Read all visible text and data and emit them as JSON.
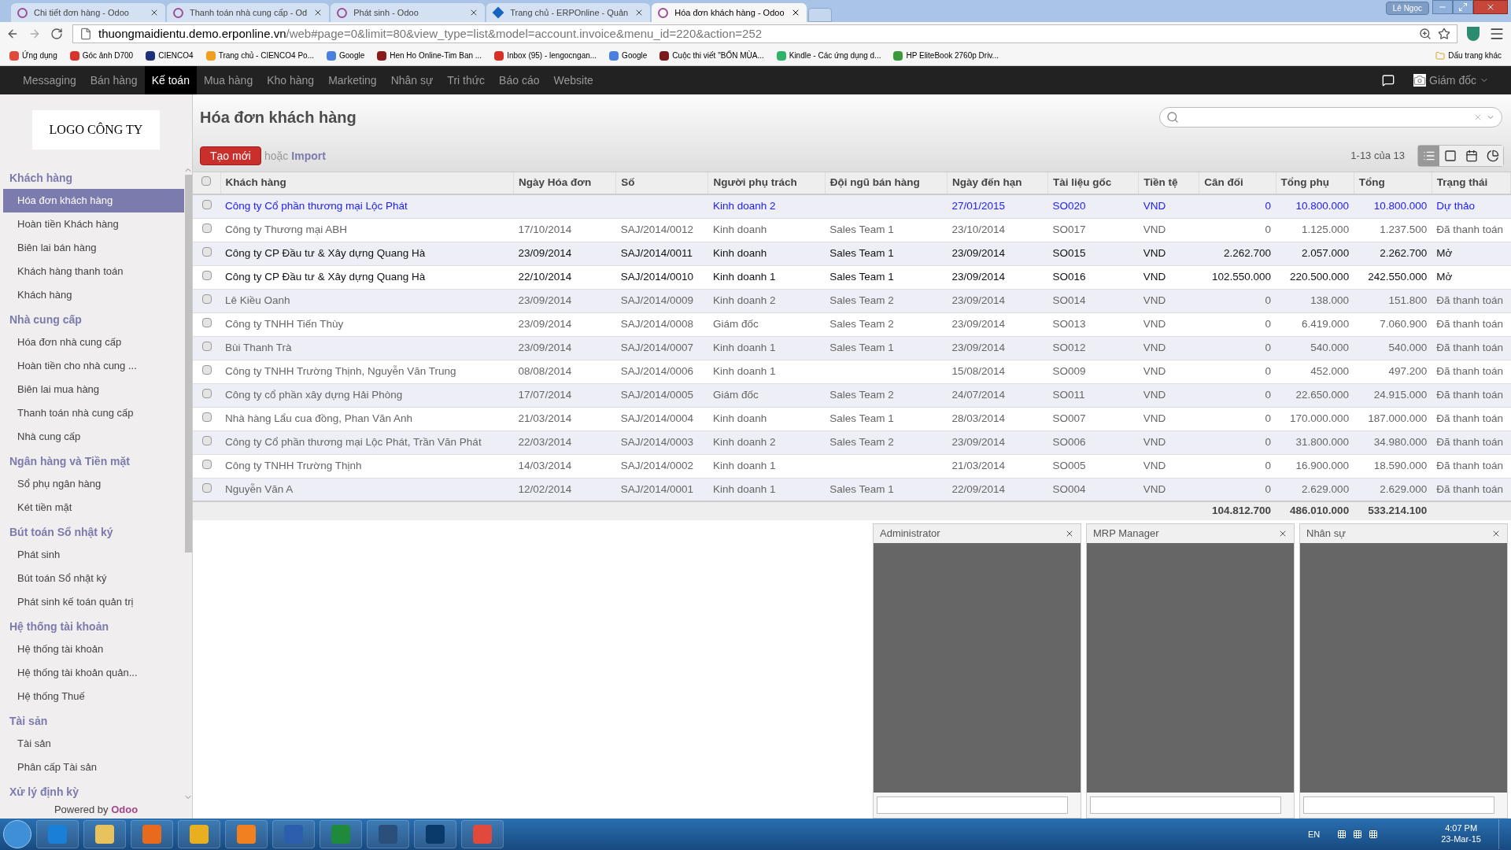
{
  "browser": {
    "tabs": [
      {
        "title": "Chi tiết đơn hàng - Odoo",
        "kind": "odoo",
        "selected": false
      },
      {
        "title": "Thanh toán nhà cung cấp - Od",
        "kind": "odoo",
        "selected": false
      },
      {
        "title": "Phát sinh - Odoo",
        "kind": "odoo",
        "selected": false
      },
      {
        "title": "Trang chủ - ERPOnline - Quản",
        "kind": "erp",
        "selected": false
      },
      {
        "title": "Hóa đơn khách hàng - Odoo",
        "kind": "odoo",
        "selected": true
      }
    ],
    "profile": "Lê Ngọc",
    "url_host": "thuongmaidientu.demo.erponline.vn",
    "url_path": "/web#page=0&limit=80&view_type=list&model=account.invoice&menu_id=220&action=252",
    "bookmarks": [
      {
        "label": "Ứng dụng",
        "color": "#e04a3c"
      },
      {
        "label": "Góc ảnh D700",
        "color": "#d9342b"
      },
      {
        "label": "CIENCO4",
        "color": "#1f2f7a"
      },
      {
        "label": "Trang chủ - CIENCO4 Po...",
        "color": "#f0a020"
      },
      {
        "label": "Google",
        "color": "#4a7fe0"
      },
      {
        "label": "Hen Ho Online-Tim Ban ...",
        "color": "#8b1a1a"
      },
      {
        "label": "Inbox (95) - lengocngan...",
        "color": "#d93025"
      },
      {
        "label": "Google",
        "color": "#4a7fe0"
      },
      {
        "label": "Cuộc thi viết \"BỐN MÙA...",
        "color": "#7a1a1a"
      },
      {
        "label": "Kindle - Các ứng dụng d...",
        "color": "#2fb36b"
      },
      {
        "label": "HP EliteBook 2760p Driv...",
        "color": "#3a9a3a"
      }
    ],
    "other_bookmarks": "Dấu trang khác"
  },
  "nav": {
    "items": [
      {
        "label": "Messaging",
        "selected": false
      },
      {
        "label": "Bán hàng",
        "selected": false
      },
      {
        "label": "Kế toán",
        "selected": true
      },
      {
        "label": "Mua hàng",
        "selected": false
      },
      {
        "label": "Kho hàng",
        "selected": false
      },
      {
        "label": "Marketing",
        "selected": false
      },
      {
        "label": "Nhân sự",
        "selected": false
      },
      {
        "label": "Tri thức",
        "selected": false
      },
      {
        "label": "Báo cáo",
        "selected": false
      },
      {
        "label": "Website",
        "selected": false
      }
    ],
    "user": "Giám đốc"
  },
  "sidebar": {
    "logo": "LOGO CÔNG TY",
    "sections": [
      {
        "title": "Khách hàng",
        "items": [
          {
            "label": "Hóa đơn khách hàng",
            "selected": true
          },
          {
            "label": "Hoàn tiền Khách hàng",
            "selected": false
          },
          {
            "label": "Biên lai bán hàng",
            "selected": false
          },
          {
            "label": "Khách hàng thanh toán",
            "selected": false
          },
          {
            "label": "Khách hàng",
            "selected": false
          }
        ]
      },
      {
        "title": "Nhà cung cấp",
        "items": [
          {
            "label": "Hóa đơn nhà cung cấp",
            "selected": false
          },
          {
            "label": "Hoàn tiền cho nhà cung ...",
            "selected": false
          },
          {
            "label": "Biên lai mua hàng",
            "selected": false
          },
          {
            "label": "Thanh toán nhà cung cấp",
            "selected": false
          },
          {
            "label": "Nhà cung cấp",
            "selected": false
          }
        ]
      },
      {
        "title": "Ngân hàng và Tiền mặt",
        "items": [
          {
            "label": "Sổ phụ ngân hàng",
            "selected": false
          },
          {
            "label": "Két tiền mặt",
            "selected": false
          }
        ]
      },
      {
        "title": "Bút toán Sổ nhật ký",
        "items": [
          {
            "label": "Phát sinh",
            "selected": false
          },
          {
            "label": "Bút toán Sổ nhật ký",
            "selected": false
          },
          {
            "label": "Phát sinh kế toán quản trị",
            "selected": false
          }
        ]
      },
      {
        "title": "Hệ thống tài khoản",
        "items": [
          {
            "label": "Hệ thống tài khoản",
            "selected": false
          },
          {
            "label": "Hệ thống tài khoản quản...",
            "selected": false
          },
          {
            "label": "Hệ thống Thuế",
            "selected": false
          }
        ]
      },
      {
        "title": "Tài sản",
        "items": [
          {
            "label": "Tài sản",
            "selected": false
          },
          {
            "label": "Phân cấp Tài sản",
            "selected": false
          }
        ]
      },
      {
        "title": "Xử lý định kỳ"
      }
    ],
    "powered_by": "Powered by",
    "powered_brand": "Odoo"
  },
  "page": {
    "title": "Hóa đơn khách hàng",
    "create_button": "Tạo mới",
    "or_text": "hoặc",
    "import_link": "Import",
    "pager": "1-13 của 13",
    "views": [
      {
        "kind": "list",
        "selected": true
      },
      {
        "kind": "form",
        "selected": false
      },
      {
        "kind": "calendar",
        "selected": false
      },
      {
        "kind": "graph",
        "selected": false
      }
    ]
  },
  "table": {
    "columns": [
      "Khách hàng",
      "Ngày Hóa đơn",
      "Số",
      "Người phụ trách",
      "Đội ngũ bán hàng",
      "Ngày đến hạn",
      "Tài liệu gốc",
      "Tiền tệ",
      "Cân đối",
      "Tổng phụ",
      "Tổng",
      "Trạng thái"
    ],
    "header_checked": false,
    "rows": [
      {
        "kind": "draft",
        "checked": false,
        "cells": [
          "Công ty Cổ phần thương mại Lộc Phát",
          "",
          "",
          "Kinh doanh 2",
          "",
          "27/01/2015",
          "SO020",
          "VND",
          "0",
          "10.800.000",
          "10.800.000",
          "Dự thảo"
        ]
      },
      {
        "kind": "paid",
        "checked": false,
        "cells": [
          "Công ty Thương mại ABH",
          "17/10/2014",
          "SAJ/2014/0012",
          "Kinh doanh",
          "Sales Team 1",
          "23/10/2014",
          "SO017",
          "VND",
          "0",
          "1.125.000",
          "1.237.500",
          "Đã thanh toán"
        ]
      },
      {
        "kind": "open",
        "checked": false,
        "cells": [
          "Công ty CP Đầu tư & Xây dựng Quang Hà",
          "23/09/2014",
          "SAJ/2014/0011",
          "Kinh doanh",
          "Sales Team 1",
          "23/09/2014",
          "SO015",
          "VND",
          "2.262.700",
          "2.057.000",
          "2.262.700",
          "Mở"
        ]
      },
      {
        "kind": "open",
        "checked": false,
        "cells": [
          "Công ty CP Đầu tư & Xây dựng Quang Hà",
          "22/10/2014",
          "SAJ/2014/0010",
          "Kinh doanh 1",
          "Sales Team 1",
          "23/09/2014",
          "SO016",
          "VND",
          "102.550.000",
          "220.500.000",
          "242.550.000",
          "Mở"
        ]
      },
      {
        "kind": "paid",
        "checked": false,
        "cells": [
          "Lê Kiều Oanh",
          "23/09/2014",
          "SAJ/2014/0009",
          "Kinh doanh 2",
          "Sales Team 2",
          "23/09/2014",
          "SO014",
          "VND",
          "0",
          "138.000",
          "151.800",
          "Đã thanh toán"
        ]
      },
      {
        "kind": "paid",
        "checked": false,
        "cells": [
          "Công ty TNHH Tiến Thùy",
          "23/09/2014",
          "SAJ/2014/0008",
          "Giám đốc",
          "Sales Team 2",
          "23/09/2014",
          "SO013",
          "VND",
          "0",
          "6.419.000",
          "7.060.900",
          "Đã thanh toán"
        ]
      },
      {
        "kind": "paid",
        "checked": false,
        "cells": [
          "Bùi Thanh Trà",
          "23/09/2014",
          "SAJ/2014/0007",
          "Kinh doanh 1",
          "Sales Team 1",
          "23/09/2014",
          "SO012",
          "VND",
          "0",
          "540.000",
          "540.000",
          "Đã thanh toán"
        ]
      },
      {
        "kind": "paid",
        "checked": false,
        "cells": [
          "Công ty TNHH Trường Thịnh, Nguyễn Văn Trung",
          "08/08/2014",
          "SAJ/2014/0006",
          "Kinh doanh 1",
          "",
          "15/08/2014",
          "SO009",
          "VND",
          "0",
          "452.000",
          "497.200",
          "Đã thanh toán"
        ]
      },
      {
        "kind": "paid",
        "checked": false,
        "cells": [
          "Công ty cổ phần xây dựng Hải Phòng",
          "17/07/2014",
          "SAJ/2014/0005",
          "Giám đốc",
          "Sales Team 2",
          "24/07/2014",
          "SO011",
          "VND",
          "0",
          "22.650.000",
          "24.915.000",
          "Đã thanh toán"
        ]
      },
      {
        "kind": "paid",
        "checked": false,
        "cells": [
          "Nhà hàng Lẩu cua đồng, Phan Văn Anh",
          "21/03/2014",
          "SAJ/2014/0004",
          "Kinh doanh",
          "Sales Team 1",
          "28/03/2014",
          "SO007",
          "VND",
          "0",
          "170.000.000",
          "187.000.000",
          "Đã thanh toán"
        ]
      },
      {
        "kind": "paid",
        "checked": false,
        "cells": [
          "Công ty Cổ phần thương mại Lộc Phát, Trần Văn Phát",
          "22/03/2014",
          "SAJ/2014/0003",
          "Kinh doanh 2",
          "Sales Team 2",
          "23/09/2014",
          "SO006",
          "VND",
          "0",
          "31.800.000",
          "34.980.000",
          "Đã thanh toán"
        ]
      },
      {
        "kind": "paid",
        "checked": false,
        "cells": [
          "Công ty TNHH Trường Thịnh",
          "14/03/2014",
          "SAJ/2014/0002",
          "Kinh doanh 1",
          "",
          "21/03/2014",
          "SO005",
          "VND",
          "0",
          "16.900.000",
          "18.590.000",
          "Đã thanh toán"
        ]
      },
      {
        "kind": "paid",
        "checked": false,
        "cells": [
          "Nguyễn Văn A",
          "12/02/2014",
          "SAJ/2014/0001",
          "Kinh doanh 1",
          "Sales Team 1",
          "22/09/2014",
          "SO004",
          "VND",
          "0",
          "2.629.000",
          "2.629.000",
          "Đã thanh toán"
        ]
      }
    ],
    "totals": [
      "104.812.700",
      "486.010.000",
      "533.214.100"
    ]
  },
  "chat_windows": [
    {
      "title": "Administrator"
    },
    {
      "title": "MRP Manager"
    },
    {
      "title": "Nhân sự"
    }
  ],
  "taskbar": {
    "language": "EN",
    "time": "4:07 PM",
    "date": "23-Mar-15"
  }
}
